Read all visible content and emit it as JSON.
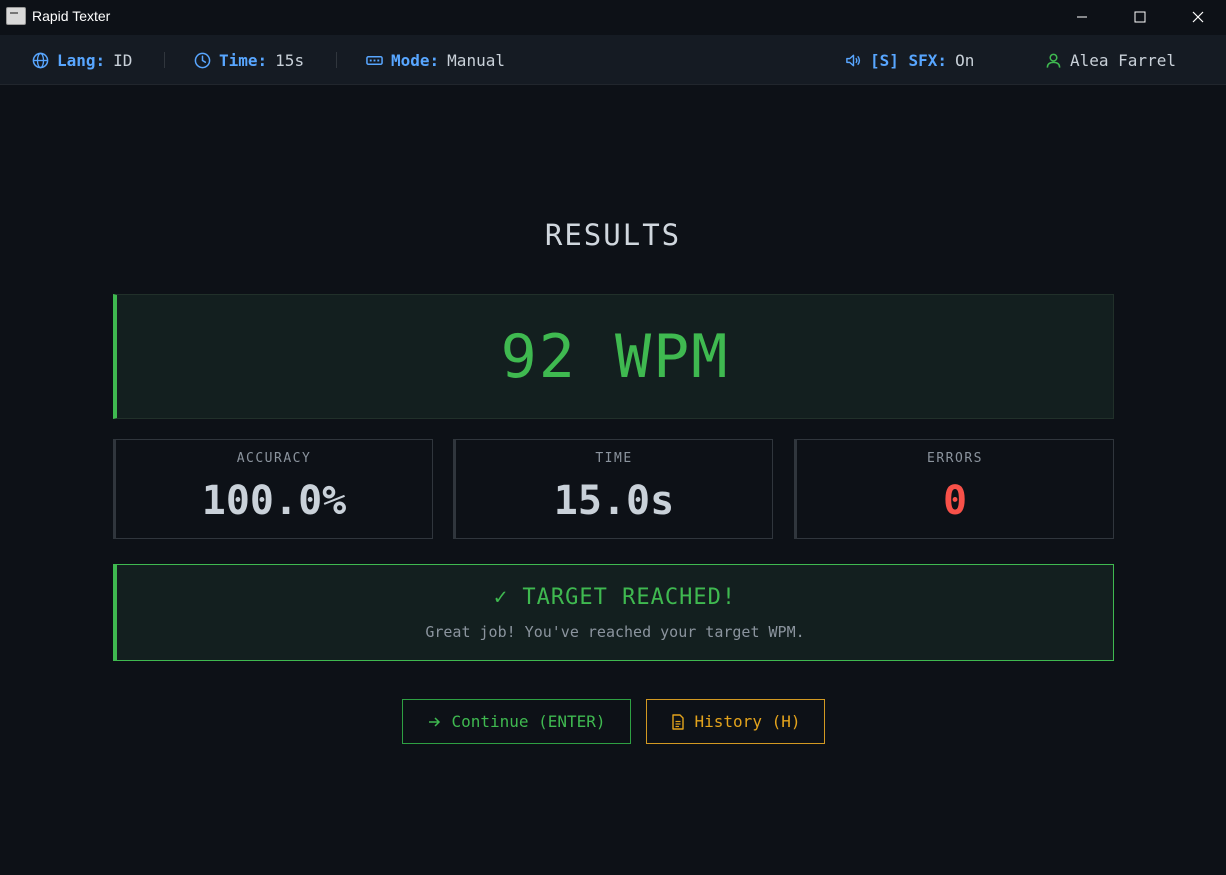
{
  "window": {
    "title": "Rapid Texter"
  },
  "topbar": {
    "lang_key": "Lang:",
    "lang_value": "ID",
    "time_key": "Time:",
    "time_value": "15s",
    "mode_key": "Mode:",
    "mode_value": "Manual",
    "sfx_key": "[S] SFX:",
    "sfx_value": "On",
    "user_name": "Alea Farrel"
  },
  "results": {
    "title": "RESULTS",
    "wpm": "92 WPM",
    "stats": [
      {
        "label": "ACCURACY",
        "value": "100.0%"
      },
      {
        "label": "TIME",
        "value": "15.0s"
      },
      {
        "label": "ERRORS",
        "value": "0"
      }
    ],
    "target": {
      "title": "✓ TARGET REACHED!",
      "subtitle": "Great job! You've reached your target WPM."
    }
  },
  "actions": {
    "continue_label": "Continue (ENTER)",
    "history_label": "History (H)"
  },
  "colors": {
    "accent_green": "#3fb950",
    "accent_blue": "#58a6ff",
    "accent_orange": "#e3a31c",
    "error_red": "#f85149"
  }
}
